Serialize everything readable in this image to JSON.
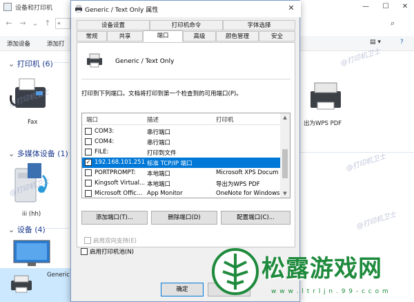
{
  "background_window": {
    "title": "设备和打印机",
    "address_fragment": "«",
    "toolbar_items": [
      "添加设备",
      "添加打"
    ],
    "groups": [
      {
        "name": "打印机 (6)"
      },
      {
        "name": "多媒体设备 (1)"
      },
      {
        "name": "设备 (4)"
      }
    ],
    "device_labels": {
      "fax": "Fax",
      "wps": "出为WPS PDF",
      "media": "iii (hh)",
      "generic": "Generic"
    }
  },
  "dialog": {
    "title": "Generic / Text Only 属性",
    "tabs_row1": [
      "设备设置",
      "打印机命令",
      "字体选择"
    ],
    "tabs_row2": [
      "常规",
      "共享",
      "端口",
      "高级",
      "颜色管理",
      "安全"
    ],
    "active_tab": "端口",
    "printer_name": "Generic / Text Only",
    "instruction": "打印到下列端口。文档将打印到第一个检查到的可用端口(P)。",
    "columns": [
      "端口",
      "描述",
      "打印机"
    ],
    "ports": [
      {
        "port": "COM3:",
        "desc": "串行端口",
        "printer": "",
        "checked": false,
        "selected": false
      },
      {
        "port": "COM4:",
        "desc": "串行端口",
        "printer": "",
        "checked": false,
        "selected": false
      },
      {
        "port": "FILE:",
        "desc": "打印到文件",
        "printer": "",
        "checked": false,
        "selected": false
      },
      {
        "port": "192.168.101.251",
        "desc": "标准 TCP/IP 端口",
        "printer": "",
        "checked": true,
        "selected": true
      },
      {
        "port": "PORTPROMPT:",
        "desc": "本地端口",
        "printer": "Microsoft XPS Docum",
        "checked": false,
        "selected": false
      },
      {
        "port": "Kingsoft Virtual...",
        "desc": "本地端口",
        "printer": "导出为WPS PDF",
        "checked": false,
        "selected": false
      },
      {
        "port": "Microsoft Offic...",
        "desc": "App Monitor",
        "printer": "OneNote for Windows",
        "checked": false,
        "selected": false
      }
    ],
    "buttons": {
      "add_port": "添加端口(T)...",
      "delete_port": "删除端口(D)",
      "configure_port": "配置端口(C)..."
    },
    "bidirectional": "启用双向支持(E)",
    "pooling": "启用打印机池(N)",
    "ok": "确定"
  },
  "watermarks": [
    "@打印机卫士"
  ],
  "logo": {
    "text": "松露游戏网",
    "url": "w w w . l t r l j n . 9 9 - c c o m"
  },
  "colors": {
    "accent": "#0078d7",
    "group_heading": "#1a3a8f",
    "logo_green": "#1e8a3c"
  }
}
